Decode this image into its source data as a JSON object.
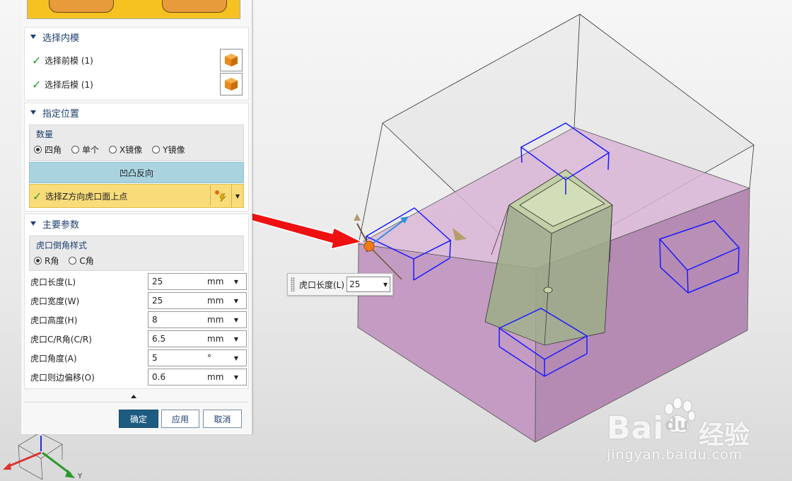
{
  "inner_mold": {
    "title": "选择内模",
    "front_label": "选择前模 (1)",
    "back_label": "选择后模 (1)"
  },
  "position": {
    "title": "指定位置",
    "quantity_title": "数量",
    "options": [
      "四角",
      "单个",
      "X镜像",
      "Y镜像"
    ],
    "selected": "四角",
    "flip_label": "凹凸反向",
    "select_point_label": "选择Z方向虎口面上点"
  },
  "params": {
    "title": "主要参数",
    "chamfer_title": "虎口倒角样式",
    "chamfer_options": [
      "R角",
      "C角"
    ],
    "chamfer_selected": "R角",
    "rows": [
      {
        "label": "虎口长度(L)",
        "value": "25",
        "unit": "mm"
      },
      {
        "label": "虎口宽度(W)",
        "value": "25",
        "unit": "mm"
      },
      {
        "label": "虎口高度(H)",
        "value": "8",
        "unit": "mm"
      },
      {
        "label": "虎口C/R角(C/R)",
        "value": "6.5",
        "unit": "mm"
      },
      {
        "label": "虎口角度(A)",
        "value": "5",
        "unit": "°"
      },
      {
        "label": "虎口则边偏移(O)",
        "value": "0.6",
        "unit": "mm"
      }
    ]
  },
  "buttons": {
    "ok": "确定",
    "apply": "应用",
    "cancel": "取消"
  },
  "floating_input": {
    "label": "虎口长度(L)",
    "value": "25"
  },
  "triad": {
    "y_label": "Y"
  },
  "watermark": {
    "brand": "Bai",
    "brand_suffix": "du",
    "cn": "经验",
    "url": "jingyan.baidu.com"
  },
  "colors": {
    "pink_block": "#c9a6c6",
    "pocket_blue": "#1a1aff",
    "accent": "#1d5c80",
    "arrow_red": "#e11"
  }
}
